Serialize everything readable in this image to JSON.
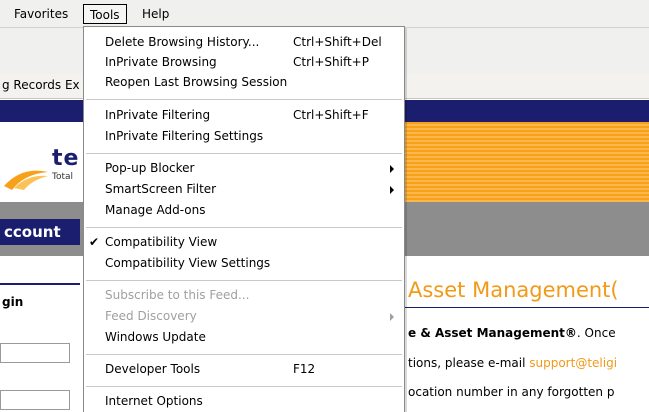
{
  "menubar": {
    "favorites": "Favorites",
    "tools": "Tools",
    "help": "Help"
  },
  "tab": {
    "label": "g Records Ex"
  },
  "page": {
    "logo_text": "te",
    "logo_sub": "Total",
    "account_label": "ccount",
    "login_label": "gin",
    "heading": "Asset Management(",
    "line1_bold": "e & Asset Management®",
    "line1_rest": ". Once",
    "line2_pre": "tions, please e-mail ",
    "line2_email": "support@teligi",
    "line3": "ocation number in any forgotten p"
  },
  "tools_menu": {
    "delete_history": {
      "label": "Delete Browsing History...",
      "shortcut": "Ctrl+Shift+Del"
    },
    "inprivate_browsing": {
      "label": "InPrivate Browsing",
      "shortcut": "Ctrl+Shift+P"
    },
    "reopen_session": {
      "label": "Reopen Last Browsing Session"
    },
    "inprivate_filtering": {
      "label": "InPrivate Filtering",
      "shortcut": "Ctrl+Shift+F"
    },
    "inprivate_filtering_settings": {
      "label": "InPrivate Filtering Settings"
    },
    "popup_blocker": {
      "label": "Pop-up Blocker"
    },
    "smartscreen": {
      "label": "SmartScreen Filter"
    },
    "manage_addons": {
      "label": "Manage Add-ons"
    },
    "compat_view": {
      "label": "Compatibility View",
      "checked": true
    },
    "compat_view_settings": {
      "label": "Compatibility View Settings"
    },
    "subscribe_feed": {
      "label": "Subscribe to this Feed...",
      "disabled": true
    },
    "feed_discovery": {
      "label": "Feed Discovery",
      "disabled": true
    },
    "windows_update": {
      "label": "Windows Update"
    },
    "developer_tools": {
      "label": "Developer Tools",
      "shortcut": "F12"
    },
    "internet_options": {
      "label": "Internet Options"
    }
  },
  "colors": {
    "navy": "#1b1e6e",
    "orange": "#f7a11a",
    "heading_orange": "#f29a18"
  }
}
